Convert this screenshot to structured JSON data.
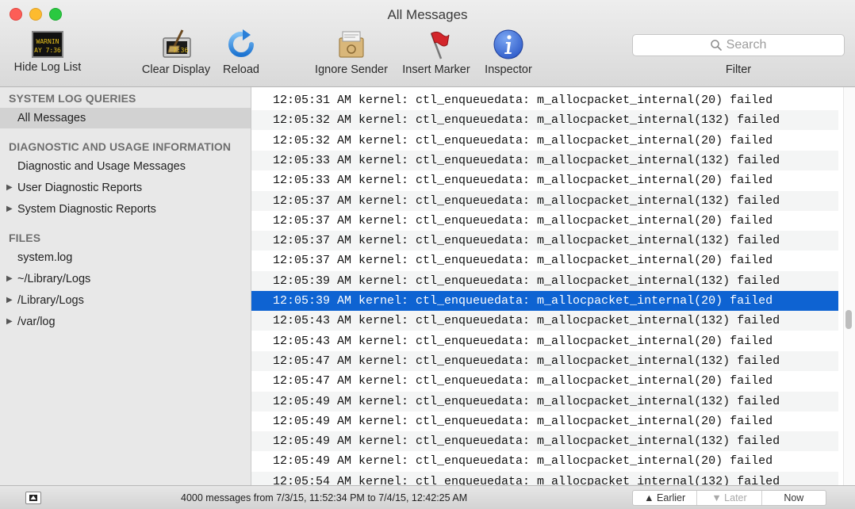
{
  "window": {
    "title": "All Messages"
  },
  "toolbar": {
    "hide_log_list": "Hide Log List",
    "clear_display": "Clear Display",
    "reload": "Reload",
    "ignore_sender": "Ignore Sender",
    "insert_marker": "Insert Marker",
    "inspector": "Inspector",
    "warning_icon_text_top": "WARNIN",
    "warning_icon_text_bottom": "AY 7:36",
    "clear_icon_text": "7:36",
    "search_placeholder": "Search",
    "filter_label": "Filter"
  },
  "sidebar": {
    "section1": "SYSTEM LOG QUERIES",
    "all_messages": "All Messages",
    "section2": "DIAGNOSTIC AND USAGE INFORMATION",
    "diag_usage": "Diagnostic and Usage Messages",
    "user_diag": "User Diagnostic Reports",
    "system_diag": "System Diagnostic Reports",
    "section3": "FILES",
    "system_log": "system.log",
    "user_library_logs": "~/Library/Logs",
    "library_logs": "/Library/Logs",
    "var_log": "/var/log"
  },
  "log": {
    "rows": [
      "12:05:31 AM kernel: ctl_enqueuedata: m_allocpacket_internal(20) failed",
      "12:05:32 AM kernel: ctl_enqueuedata: m_allocpacket_internal(132) failed",
      "12:05:32 AM kernel: ctl_enqueuedata: m_allocpacket_internal(20) failed",
      "12:05:33 AM kernel: ctl_enqueuedata: m_allocpacket_internal(132) failed",
      "12:05:33 AM kernel: ctl_enqueuedata: m_allocpacket_internal(20) failed",
      "12:05:37 AM kernel: ctl_enqueuedata: m_allocpacket_internal(132) failed",
      "12:05:37 AM kernel: ctl_enqueuedata: m_allocpacket_internal(20) failed",
      "12:05:37 AM kernel: ctl_enqueuedata: m_allocpacket_internal(132) failed",
      "12:05:37 AM kernel: ctl_enqueuedata: m_allocpacket_internal(20) failed",
      "12:05:39 AM kernel: ctl_enqueuedata: m_allocpacket_internal(132) failed",
      "12:05:39 AM kernel: ctl_enqueuedata: m_allocpacket_internal(20) failed",
      "12:05:43 AM kernel: ctl_enqueuedata: m_allocpacket_internal(132) failed",
      "12:05:43 AM kernel: ctl_enqueuedata: m_allocpacket_internal(20) failed",
      "12:05:47 AM kernel: ctl_enqueuedata: m_allocpacket_internal(132) failed",
      "12:05:47 AM kernel: ctl_enqueuedata: m_allocpacket_internal(20) failed",
      "12:05:49 AM kernel: ctl_enqueuedata: m_allocpacket_internal(132) failed",
      "12:05:49 AM kernel: ctl_enqueuedata: m_allocpacket_internal(20) failed",
      "12:05:49 AM kernel: ctl_enqueuedata: m_allocpacket_internal(132) failed",
      "12:05:49 AM kernel: ctl_enqueuedata: m_allocpacket_internal(20) failed",
      "12:05:54 AM kernel: ctl_enqueuedata: m_allocpacket_internal(132) failed"
    ],
    "selected_index": 10
  },
  "status": {
    "message": "4000 messages from 7/3/15, 11:52:34 PM to 7/4/15, 12:42:25 AM",
    "earlier": "Earlier",
    "later": "Later",
    "now": "Now"
  },
  "colors": {
    "selection": "#0e63d2",
    "inspector_blue": "#3b6fd8",
    "marker_red": "#d3252a"
  }
}
